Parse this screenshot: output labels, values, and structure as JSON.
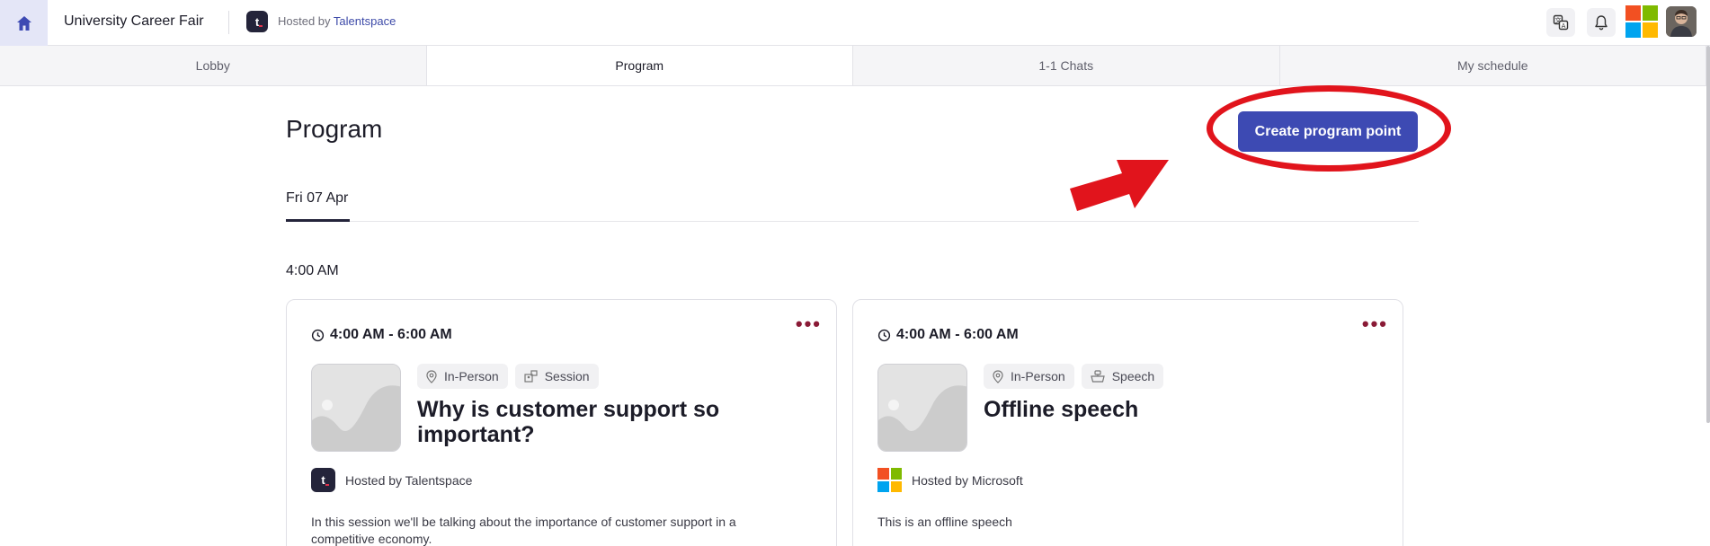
{
  "header": {
    "title": "University Career Fair",
    "hosted_prefix": "Hosted by ",
    "host_name": "Talentspace",
    "host_logo_letter": "t"
  },
  "tabs": [
    {
      "label": "Lobby",
      "active": false
    },
    {
      "label": "Program",
      "active": true
    },
    {
      "label": "1-1 Chats",
      "active": false
    },
    {
      "label": "My schedule",
      "active": false
    }
  ],
  "main": {
    "title": "Program",
    "create_button": "Create program point",
    "day_tab": "Fri 07 Apr",
    "time_heading": "4:00 AM"
  },
  "cards": [
    {
      "time": "4:00 AM - 6:00 AM",
      "tags": [
        "In-Person",
        "Session"
      ],
      "title": "Why is customer support so important?",
      "host": "Hosted by Talentspace",
      "description": "In this session we'll be talking about the importance of customer support in a competitive economy."
    },
    {
      "time": "4:00 AM - 6:00 AM",
      "tags": [
        "In-Person",
        "Speech"
      ],
      "title": "Offline speech",
      "host": "Hosted by Microsoft",
      "description": "This is an offline speech"
    }
  ],
  "colors": {
    "accent": "#3d4ab3",
    "annotation": "#e1141c",
    "ms_red": "#f25022",
    "ms_green": "#7fba00",
    "ms_blue": "#00a4ef",
    "ms_yellow": "#ffb900"
  },
  "icons": {
    "home": "home-icon",
    "translate": "translate-icon",
    "notifications": "bell-icon",
    "clock": "clock-icon",
    "location": "location-pin-icon",
    "session": "session-icon",
    "speech": "speech-icon",
    "more": "more-dots-icon"
  }
}
